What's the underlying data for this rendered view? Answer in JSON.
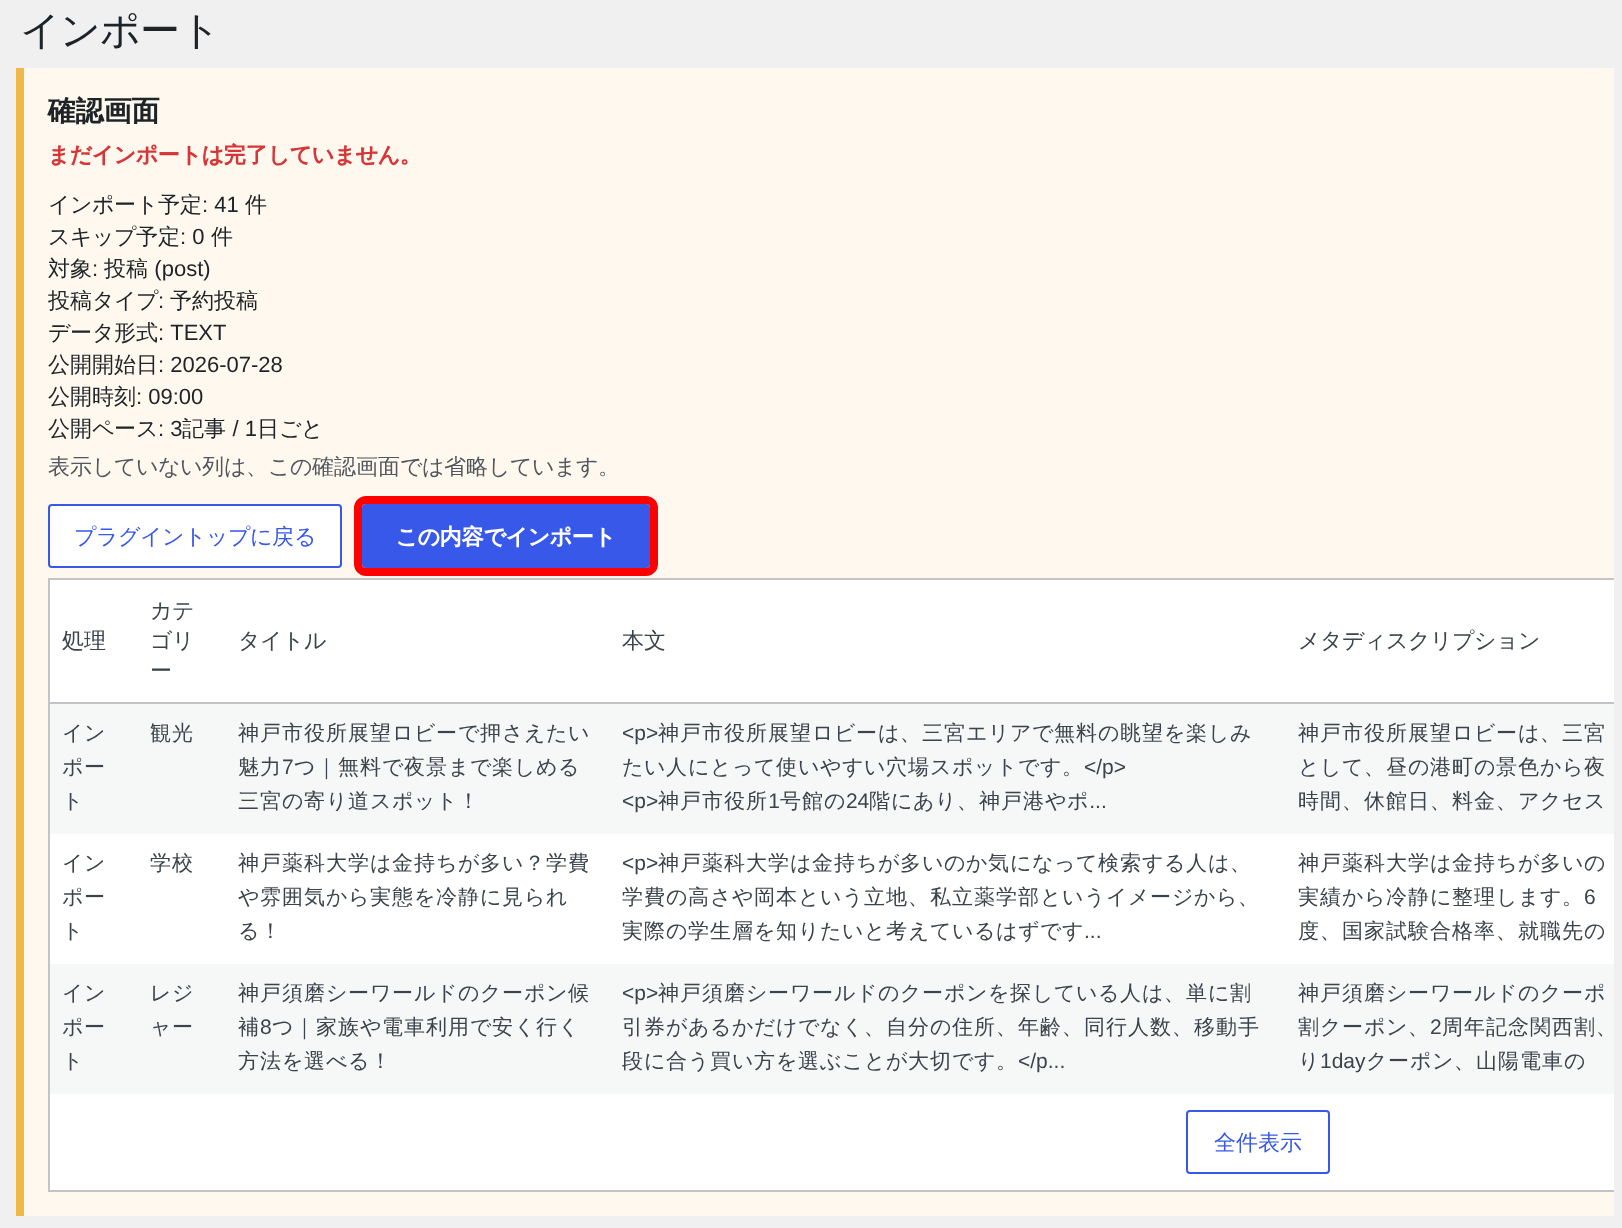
{
  "page_title": "インポート",
  "notice": {
    "heading": "確認画面",
    "warning": "まだインポートは完了していません。",
    "details": [
      "インポート予定: 41 件",
      "スキップ予定: 0 件",
      "対象: 投稿 (post)",
      "投稿タイプ: 予約投稿",
      "データ形式: TEXT",
      "公開開始日: 2026-07-28",
      "公開時刻: 09:00",
      "公開ペース: 3記事 / 1日ごと"
    ],
    "note": "表示していない列は、この確認画面では省略しています。",
    "buttons": [
      {
        "label": "プラグイントップに戻る",
        "kind": "secondary",
        "highlighted": false
      },
      {
        "label": "この内容でインポート",
        "kind": "primary",
        "highlighted": true
      }
    ]
  },
  "table": {
    "columns": [
      "処理",
      "カテゴリー",
      "タイトル",
      "本文",
      "メタディスクリプション"
    ],
    "rows": [
      {
        "action": "インポート",
        "category": "観光",
        "title": "神戸市役所展望ロビーで押さえたい魅力7つ｜無料で夜景まで楽しめる三宮の寄り道スポット！",
        "body": "<p>神戸市役所展望ロビーは、三宮エリアで無料の眺望を楽しみたい人にとって使いやすい穴場スポットです。</p>\n<p>神戸市役所1号館の24階にあり、神戸港やポ...",
        "meta": [
          "神戸市役所展望ロビーは、三宮",
          "として、昼の港町の景色から夜",
          "時間、休館日、料金、アクセス"
        ]
      },
      {
        "action": "インポート",
        "category": "学校",
        "title": "神戸薬科大学は金持ちが多い？学費や雰囲気から実態を冷静に見られる！",
        "body": "<p>神戸薬科大学は金持ちが多いのか気になって検索する人は、学費の高さや岡本という立地、私立薬学部というイメージから、実際の学生層を知りたいと考えているはずです...",
        "meta": [
          "神戸薬科大学は金持ちが多いの",
          "実績から冷静に整理します。6",
          "度、国家試験合格率、就職先の"
        ]
      },
      {
        "action": "インポート",
        "category": "レジャー",
        "title": "神戸須磨シーワールドのクーポン候補8つ｜家族や電車利用で安く行く方法を選べる！",
        "body": "<p>神戸須磨シーワールドのクーポンを探している人は、単に割引券があるかだけでなく、自分の住所、年齢、同行人数、移動手段に合う買い方を選ぶことが大切です。</p...",
        "meta": [
          "神戸須磨シーワールドのクーポ",
          "割クーポン、2周年記念関西割、",
          "り1dayクーポン、山陽電車の"
        ]
      }
    ],
    "show_all_button": "全件表示"
  }
}
